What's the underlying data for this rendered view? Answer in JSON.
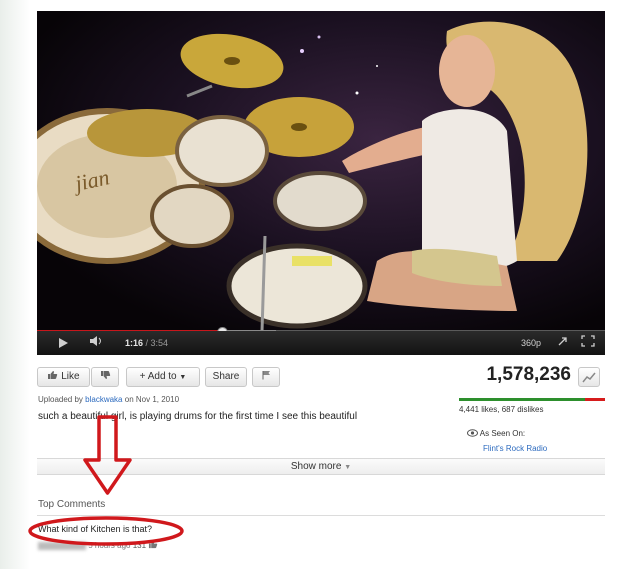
{
  "player": {
    "current_time": "1:16",
    "duration": "/ 3:54",
    "progress": 0.325,
    "buffered": 0.42,
    "quality": "360p"
  },
  "actions": {
    "like_label": "Like",
    "add_to_label": "+ Add to",
    "share_label": "Share"
  },
  "stats": {
    "views": "1,578,236",
    "likes_dislikes": "4,441 likes, 687 dislikes",
    "like_ratio": 0.866
  },
  "upload": {
    "prefix": "Uploaded by",
    "user": "blackwaka",
    "date": "on Nov 1, 2010"
  },
  "description": "such a beautiful girl, is playing drums for the first time I see this beautiful",
  "as_seen_on": {
    "label": "As Seen On:",
    "source": "Flint's Rock Radio"
  },
  "show_more": "Show more",
  "comments": {
    "header": "Top Comments",
    "items": [
      {
        "text": "What kind of Kitchen is that?",
        "time": "5 hours ago",
        "likes": "131"
      }
    ]
  },
  "colors": {
    "progress_red": "#c8161b",
    "annotation_red": "#d0181c",
    "link_blue": "#2d6bbf"
  }
}
